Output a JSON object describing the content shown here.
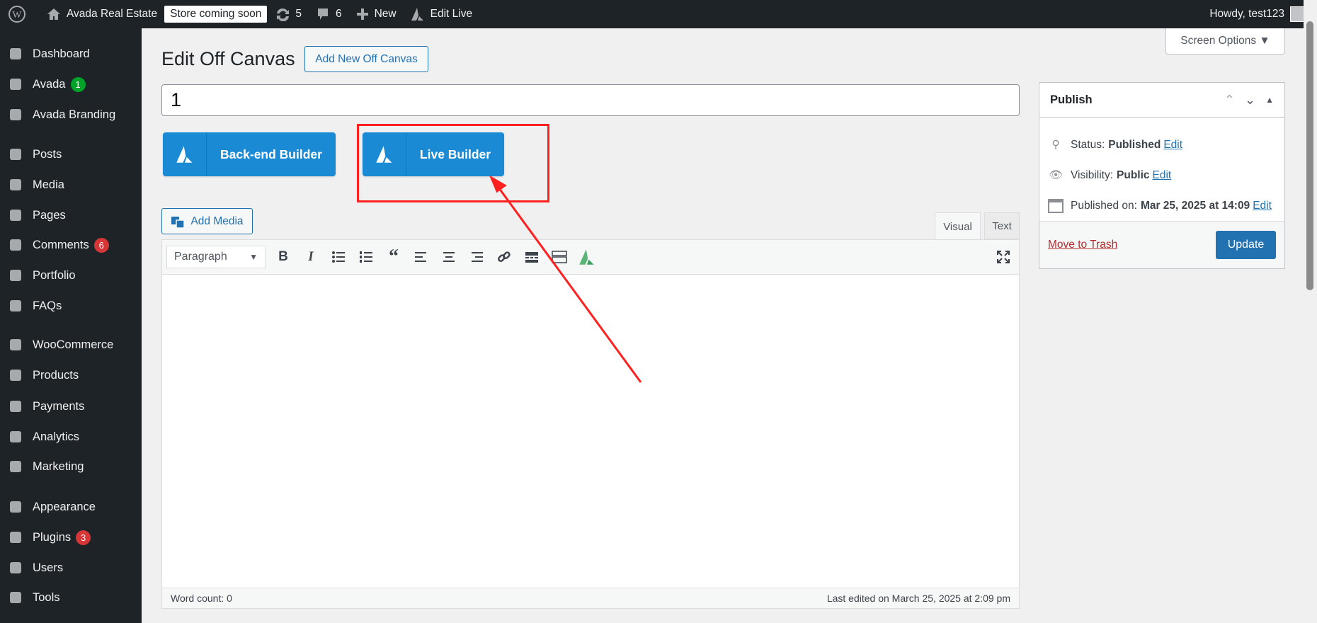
{
  "topbar": {
    "site": "Avada Real Estate",
    "store": "Store coming soon",
    "updates": "5",
    "comments": "6",
    "new": "New",
    "edit_live": "Edit Live",
    "howdy": "Howdy, test123"
  },
  "sidebar": {
    "items": [
      {
        "label": "Dashboard",
        "icon": "dashboard-icon"
      },
      {
        "label": "Avada",
        "icon": "avada-icon",
        "badge": "1",
        "badge_color": "#00a32a"
      },
      {
        "label": "Avada Branding",
        "icon": "avada-icon"
      },
      {
        "label": "Posts",
        "icon": "pin-icon"
      },
      {
        "label": "Media",
        "icon": "media-icon"
      },
      {
        "label": "Pages",
        "icon": "pages-icon"
      },
      {
        "label": "Comments",
        "icon": "comment-icon",
        "badge": "6",
        "badge_color": "#d63638"
      },
      {
        "label": "Portfolio",
        "icon": "portfolio-icon"
      },
      {
        "label": "FAQs",
        "icon": "info-icon"
      },
      {
        "label": "WooCommerce",
        "icon": "woo-icon"
      },
      {
        "label": "Products",
        "icon": "archive-icon"
      },
      {
        "label": "Payments",
        "icon": "dollar-icon"
      },
      {
        "label": "Analytics",
        "icon": "chart-icon"
      },
      {
        "label": "Marketing",
        "icon": "megaphone-icon"
      },
      {
        "label": "Appearance",
        "icon": "brush-icon"
      },
      {
        "label": "Plugins",
        "icon": "plugin-icon",
        "badge": "3",
        "badge_color": "#d63638"
      },
      {
        "label": "Users",
        "icon": "user-icon"
      },
      {
        "label": "Tools",
        "icon": "wrench-icon"
      }
    ]
  },
  "screen_options": "Screen Options ▼",
  "page": {
    "title": "Edit Off Canvas",
    "add_new": "Add New Off Canvas",
    "post_title": "1"
  },
  "builders": {
    "backend": "Back-end Builder",
    "live": "Live Builder"
  },
  "editor": {
    "add_media": "Add Media",
    "tab_visual": "Visual",
    "tab_text": "Text",
    "format": "Paragraph",
    "word_count": "Word count: 0",
    "last_edited": "Last edited on March 25, 2025 at 2:09 pm"
  },
  "publish": {
    "title": "Publish",
    "status_label": "Status:",
    "status": "Published",
    "visibility_label": "Visibility:",
    "visibility": "Public",
    "published_label": "Published on:",
    "published": "Mar 25, 2025 at 14:09",
    "edit": "Edit",
    "trash": "Move to Trash",
    "update": "Update"
  },
  "colors": {
    "accent": "#2271b1",
    "builder": "#1a8ad4",
    "annotation": "#ff2020"
  }
}
